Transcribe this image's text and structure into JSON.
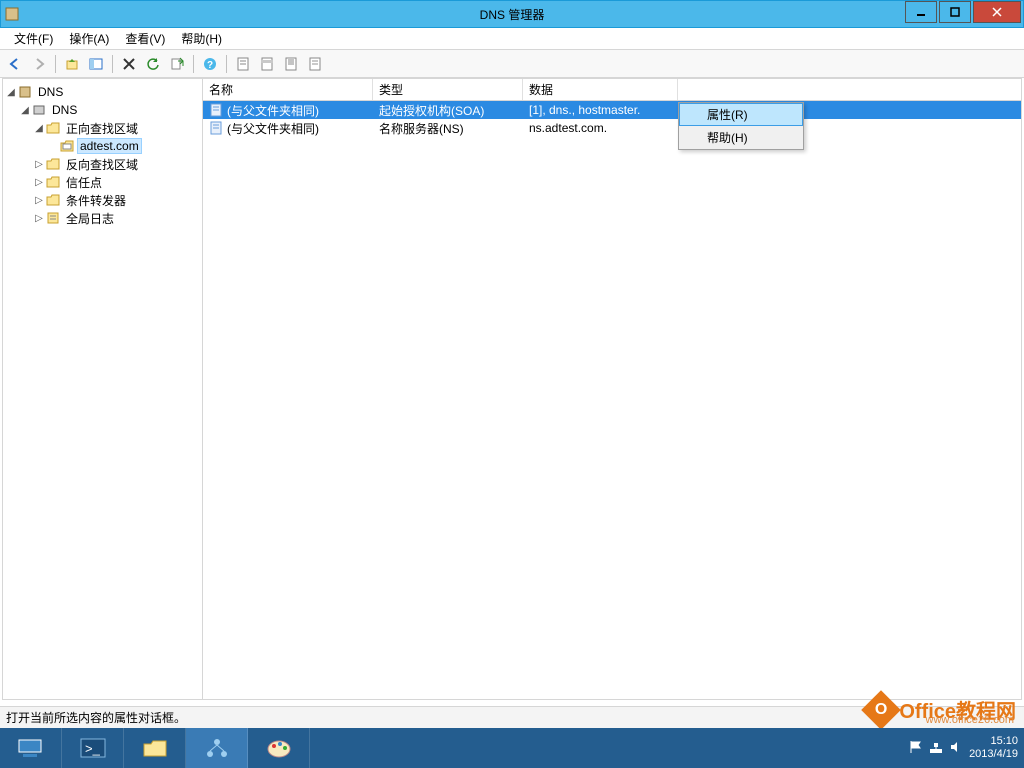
{
  "window": {
    "title": "DNS 管理器"
  },
  "menubar": {
    "file": "文件(F)",
    "action": "操作(A)",
    "view": "查看(V)",
    "help": "帮助(H)"
  },
  "tree": {
    "root": "DNS",
    "server": "DNS",
    "fwd_zone": "正向查找区域",
    "zone_adtest": "adtest.com",
    "rev_zone": "反向查找区域",
    "trust": "信任点",
    "cond_fwd": "条件转发器",
    "global_log": "全局日志"
  },
  "columns": {
    "name": "名称",
    "type": "类型",
    "data": "数据"
  },
  "rows": [
    {
      "name": "(与父文件夹相同)",
      "type": "起始授权机构(SOA)",
      "data": "[1], dns., hostmaster."
    },
    {
      "name": "(与父文件夹相同)",
      "type": "名称服务器(NS)",
      "data": "ns.adtest.com."
    }
  ],
  "context_menu": {
    "properties": "属性(R)",
    "help": "帮助(H)"
  },
  "statusbar": {
    "text": "打开当前所选内容的属性对话框。"
  },
  "tray": {
    "time": "15:10",
    "date": "2013/4/19"
  },
  "watermark": {
    "brand": "Office教程网",
    "url": "www.office26.com"
  }
}
